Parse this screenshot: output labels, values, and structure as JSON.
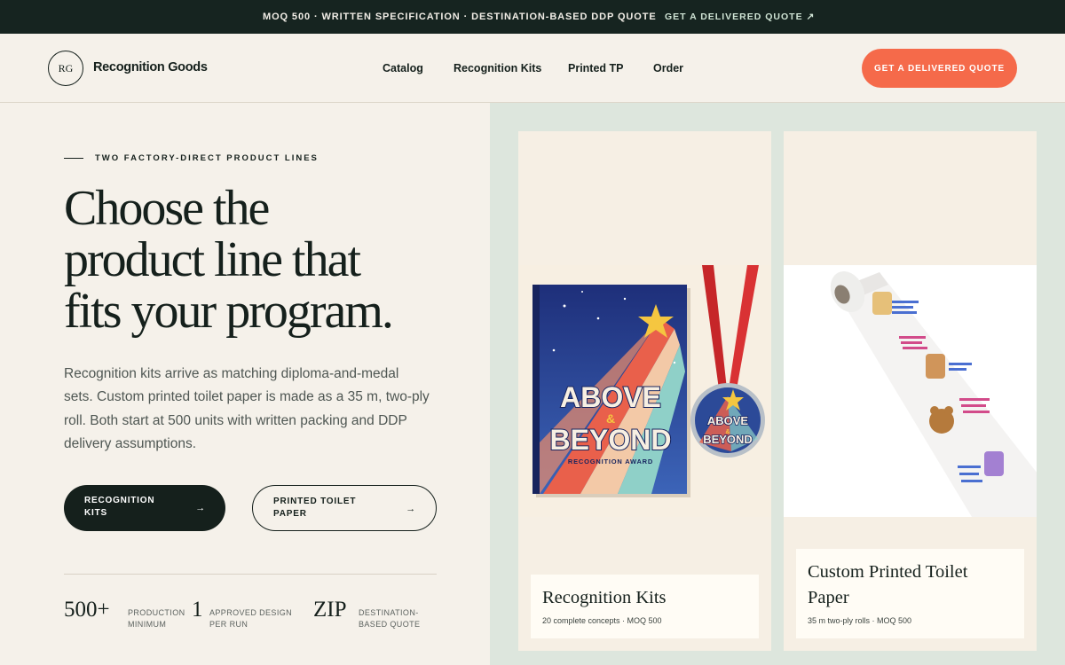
{
  "announcement": {
    "message": "MOQ 500 · WRITTEN SPECIFICATION · DESTINATION-BASED DDP QUOTE",
    "link": "GET A DELIVERED QUOTE ↗"
  },
  "header": {
    "logo_mark": "RG",
    "brand": "Recognition Goods",
    "nav": [
      "Catalog",
      "Recognition Kits",
      "Printed TP",
      "Order"
    ],
    "cta": "GET A DELIVERED QUOTE"
  },
  "hero": {
    "eyebrow": "TWO FACTORY-DIRECT PRODUCT LINES",
    "headline_lines": [
      "Choose the",
      "product line that",
      "fits your program."
    ],
    "lead": "Recognition kits arrive as matching diploma-and-medal sets. Custom printed toilet paper is made as a 35 m, two-ply roll. Both start at 500 units with written packing and DDP delivery assumptions.",
    "buttons": [
      {
        "label": "RECOGNITION KITS",
        "arrow": "→"
      },
      {
        "label": "PRINTED TOILET PAPER",
        "arrow": "→"
      }
    ],
    "stats": [
      {
        "value": "500+",
        "label": "PRODUCTION MINIMUM"
      },
      {
        "value": "1",
        "label": "APPROVED DESIGN PER RUN"
      },
      {
        "value": "ZIP",
        "label": "DESTINATION-BASED QUOTE"
      }
    ]
  },
  "cards": [
    {
      "title": "Recognition Kits",
      "subtitle": "20 complete concepts · MOQ 500",
      "art": {
        "book_line1": "ABOVE",
        "book_amp": "&",
        "book_line2": "BEYOND",
        "book_sub": "RECOGNITION AWARD",
        "medal_line1": "ABOVE",
        "medal_amp": "&",
        "medal_line2": "BEYOND"
      }
    },
    {
      "title": "Custom Printed Toilet Paper",
      "subtitle": "35 m two-ply rolls · MOQ 500"
    }
  ],
  "colors": {
    "dark": "#15201c",
    "cream": "#f5f1ea",
    "accent": "#f56a4a",
    "panel": "#dde6dd"
  }
}
